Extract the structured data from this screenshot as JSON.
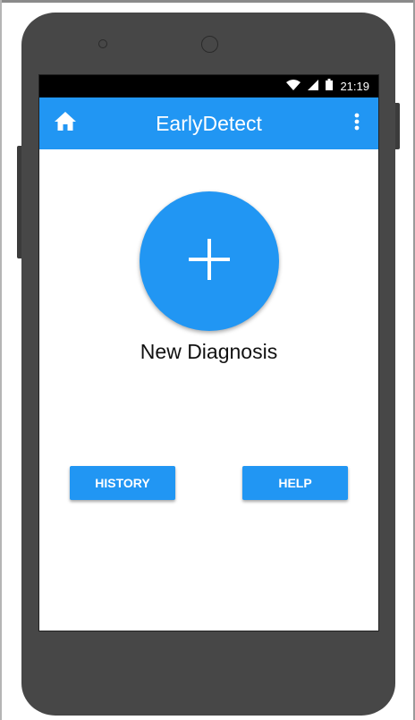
{
  "status_bar": {
    "time": "21:19",
    "icons": [
      "wifi-icon",
      "signal-icon",
      "battery-icon"
    ]
  },
  "app_bar": {
    "title": "EarlyDetect",
    "left_icon": "home-icon",
    "right_icon": "more-vert-icon"
  },
  "main": {
    "fab_icon": "plus-icon",
    "fab_label": "New Diagnosis",
    "history_label": "HISTORY",
    "help_label": "HELP"
  },
  "colors": {
    "primary": "#2196F3",
    "status_bar": "#000000",
    "device_body": "#474747"
  }
}
